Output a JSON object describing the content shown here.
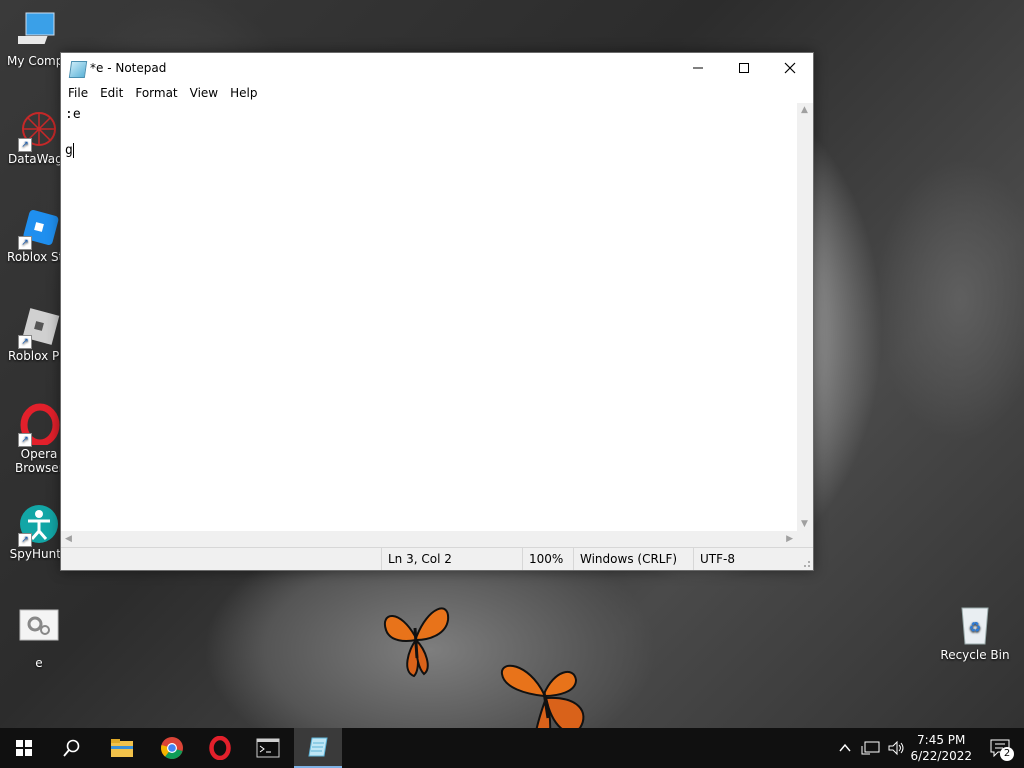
{
  "desktop": {
    "icons": [
      {
        "label": "My Compu"
      },
      {
        "label": "DataWago"
      },
      {
        "label": "Roblox Stu"
      },
      {
        "label": "Roblox Pla"
      },
      {
        "label": "Opera Browser"
      },
      {
        "label": "SpyHunte"
      },
      {
        "label": "e"
      },
      {
        "label": "Recycle Bin"
      }
    ]
  },
  "window": {
    "title": "*e - Notepad",
    "menu": [
      "File",
      "Edit",
      "Format",
      "View",
      "Help"
    ],
    "content": [
      ":e",
      "",
      "g"
    ],
    "status": {
      "position": "Ln 3, Col 2",
      "zoom": "100%",
      "line_ending": "Windows (CRLF)",
      "encoding": "UTF-8"
    }
  },
  "taskbar": {
    "items": [
      "start-icon",
      "search-icon",
      "file-explorer-icon",
      "chrome-icon",
      "opera-icon",
      "terminal-icon",
      "notepad-icon"
    ],
    "clock": {
      "time": "7:45 PM",
      "date": "6/22/2022"
    },
    "notification_count": "2"
  },
  "colors": {
    "accent": "#7fb2e5",
    "taskbar": "#101010",
    "butterfly": "#e8731a"
  }
}
